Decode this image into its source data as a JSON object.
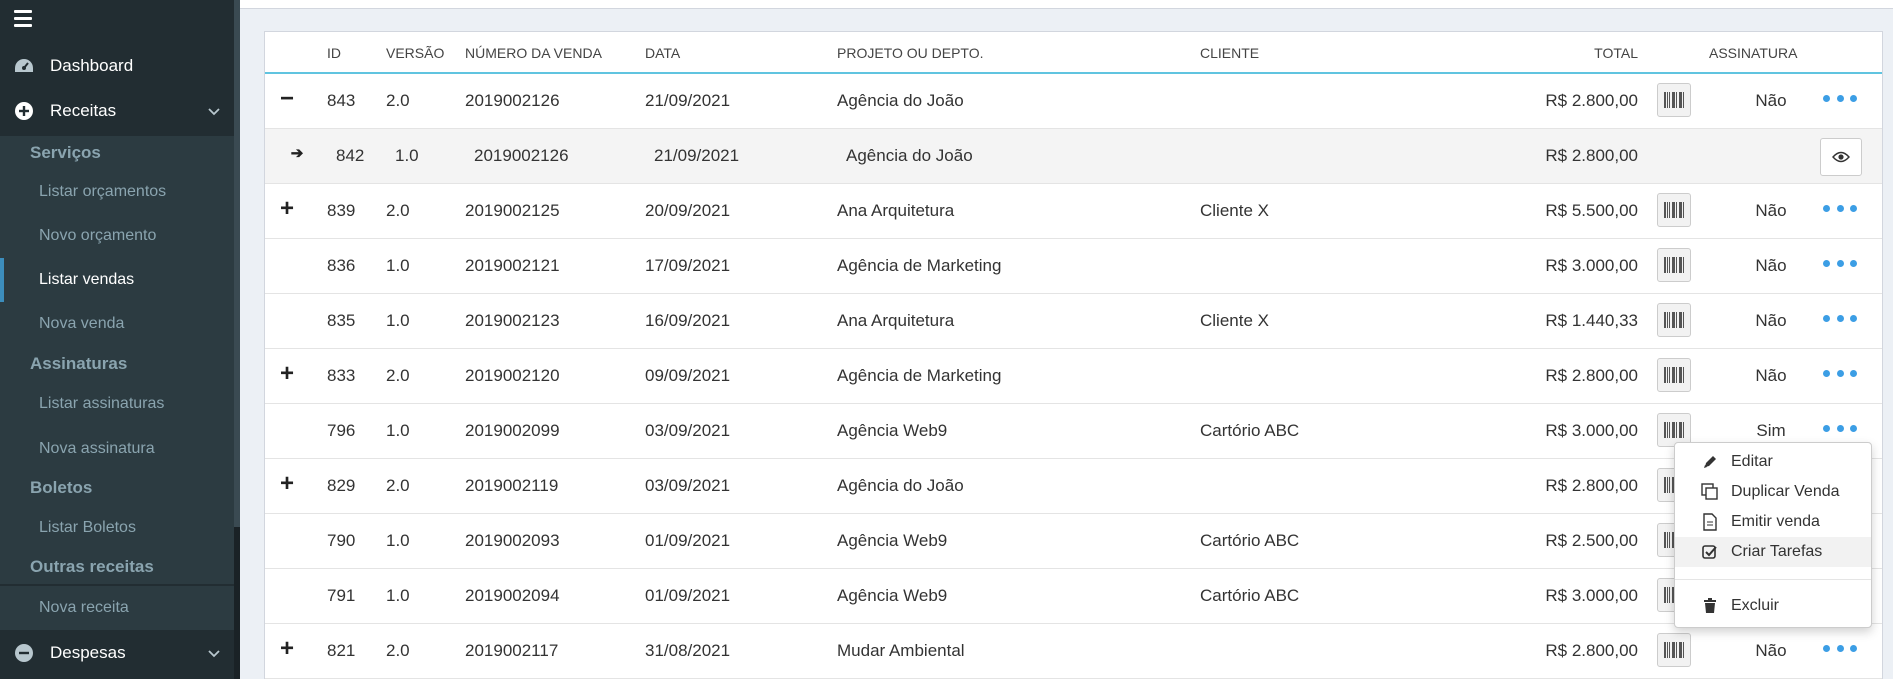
{
  "sidebar": {
    "dashboard": "Dashboard",
    "receitas": "Receitas",
    "servicos": "Serviços",
    "listar_orcamentos": "Listar orçamentos",
    "novo_orcamento": "Novo orçamento",
    "listar_vendas": "Listar vendas",
    "nova_venda": "Nova venda",
    "assinaturas": "Assinaturas",
    "listar_assinaturas": "Listar assinaturas",
    "nova_assinatura": "Nova assinatura",
    "boletos": "Boletos",
    "listar_boletos": "Listar Boletos",
    "outras_receitas": "Outras receitas",
    "nova_receita": "Nova receita",
    "despesas": "Despesas"
  },
  "table": {
    "headers": {
      "id": "ID",
      "versao": "VERSÃO",
      "numero": "NÚMERO DA VENDA",
      "data": "DATA",
      "projeto": "PROJETO OU DEPTO.",
      "cliente": "CLIENTE",
      "total": "TOTAL",
      "assinatura": "ASSINATURA"
    },
    "rows": [
      {
        "expander": "−",
        "id": "843",
        "versao": "2.0",
        "numero": "2019002126",
        "data": "21/09/2021",
        "projeto": "Agência do João",
        "cliente": "",
        "total": "R$ 2.800,00",
        "assinatura": "Não"
      },
      {
        "expander": "➔",
        "id": "842",
        "versao": "1.0",
        "numero": "2019002126",
        "data": "21/09/2021",
        "projeto": "Agência do João",
        "cliente": "",
        "total": "R$ 2.800,00",
        "assinatura": ""
      },
      {
        "expander": "+",
        "id": "839",
        "versao": "2.0",
        "numero": "2019002125",
        "data": "20/09/2021",
        "projeto": "Ana Arquitetura",
        "cliente": "Cliente X",
        "total": "R$ 5.500,00",
        "assinatura": "Não"
      },
      {
        "expander": "",
        "id": "836",
        "versao": "1.0",
        "numero": "2019002121",
        "data": "17/09/2021",
        "projeto": "Agência de Marketing",
        "cliente": "",
        "total": "R$ 3.000,00",
        "assinatura": "Não"
      },
      {
        "expander": "",
        "id": "835",
        "versao": "1.0",
        "numero": "2019002123",
        "data": "16/09/2021",
        "projeto": "Ana Arquitetura",
        "cliente": "Cliente X",
        "total": "R$ 1.440,33",
        "assinatura": "Não"
      },
      {
        "expander": "+",
        "id": "833",
        "versao": "2.0",
        "numero": "2019002120",
        "data": "09/09/2021",
        "projeto": "Agência de Marketing",
        "cliente": "",
        "total": "R$ 2.800,00",
        "assinatura": "Não"
      },
      {
        "expander": "",
        "id": "796",
        "versao": "1.0",
        "numero": "2019002099",
        "data": "03/09/2021",
        "projeto": "Agência Web9",
        "cliente": "Cartório ABC",
        "total": "R$ 3.000,00",
        "assinatura": "Sim"
      },
      {
        "expander": "+",
        "id": "829",
        "versao": "2.0",
        "numero": "2019002119",
        "data": "03/09/2021",
        "projeto": "Agência do João",
        "cliente": "",
        "total": "R$ 2.800,00",
        "assinatura": ""
      },
      {
        "expander": "",
        "id": "790",
        "versao": "1.0",
        "numero": "2019002093",
        "data": "01/09/2021",
        "projeto": "Agência Web9",
        "cliente": "Cartório ABC",
        "total": "R$ 2.500,00",
        "assinatura": ""
      },
      {
        "expander": "",
        "id": "791",
        "versao": "1.0",
        "numero": "2019002094",
        "data": "01/09/2021",
        "projeto": "Agência Web9",
        "cliente": "Cartório ABC",
        "total": "R$ 3.000,00",
        "assinatura": ""
      },
      {
        "expander": "+",
        "id": "821",
        "versao": "2.0",
        "numero": "2019002117",
        "data": "31/08/2021",
        "projeto": "Mudar Ambiental",
        "cliente": "",
        "total": "R$ 2.800,00",
        "assinatura": "Não"
      }
    ]
  },
  "dropdown": {
    "editar": "Editar",
    "duplicar": "Duplicar Venda",
    "emitir": "Emitir venda",
    "criar_tarefas": "Criar Tarefas",
    "excluir": "Excluir"
  },
  "colors": {
    "sidebar_bg": "#222d32",
    "submenu_bg": "#2c3b41",
    "active_accent": "#3c8dbc",
    "header_underline": "#60c4e0",
    "dots": "#3c9ee5"
  }
}
